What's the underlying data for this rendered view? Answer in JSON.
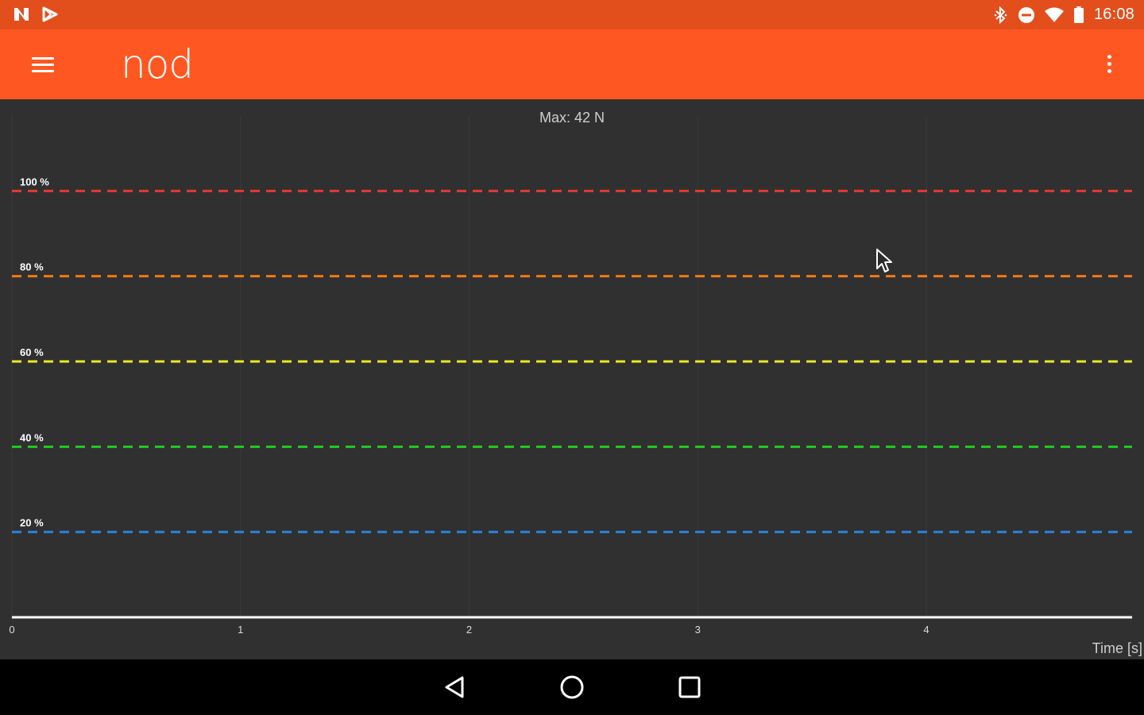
{
  "status_bar": {
    "time": "16:08",
    "icons": [
      "n-notification-icon",
      "play-store-icon",
      "bluetooth-icon",
      "do-not-disturb-icon",
      "wifi-icon",
      "battery-icon"
    ]
  },
  "app_bar": {
    "title": "nod",
    "menu_icon": "hamburger-menu-icon",
    "overflow_icon": "overflow-menu-icon",
    "color": "#FF5722"
  },
  "chart_data": {
    "type": "line",
    "title": "Max: 42 N",
    "xlabel": "Time [s]",
    "ylabel": "",
    "x_ticks": [
      0,
      1,
      2,
      3,
      4
    ],
    "xlim": [
      0,
      4.9
    ],
    "ylim": [
      0,
      120
    ],
    "grid": true,
    "thresholds": [
      {
        "label": "100 %",
        "value": 100,
        "color": "#E53935"
      },
      {
        "label": "80 %",
        "value": 80,
        "color": "#EF7A1A"
      },
      {
        "label": "60 %",
        "value": 60,
        "color": "#E8E828"
      },
      {
        "label": "40 %",
        "value": 40,
        "color": "#22CC22"
      },
      {
        "label": "20 %",
        "value": 20,
        "color": "#2F7FD8"
      }
    ],
    "series": [
      {
        "x": [
          0,
          4.9
        ],
        "y": [
          0,
          0
        ],
        "color": "#FFFFFF"
      }
    ]
  },
  "nav_bar": {
    "back_icon": "back-triangle-icon",
    "home_icon": "home-circle-icon",
    "recents_icon": "recents-square-icon"
  }
}
